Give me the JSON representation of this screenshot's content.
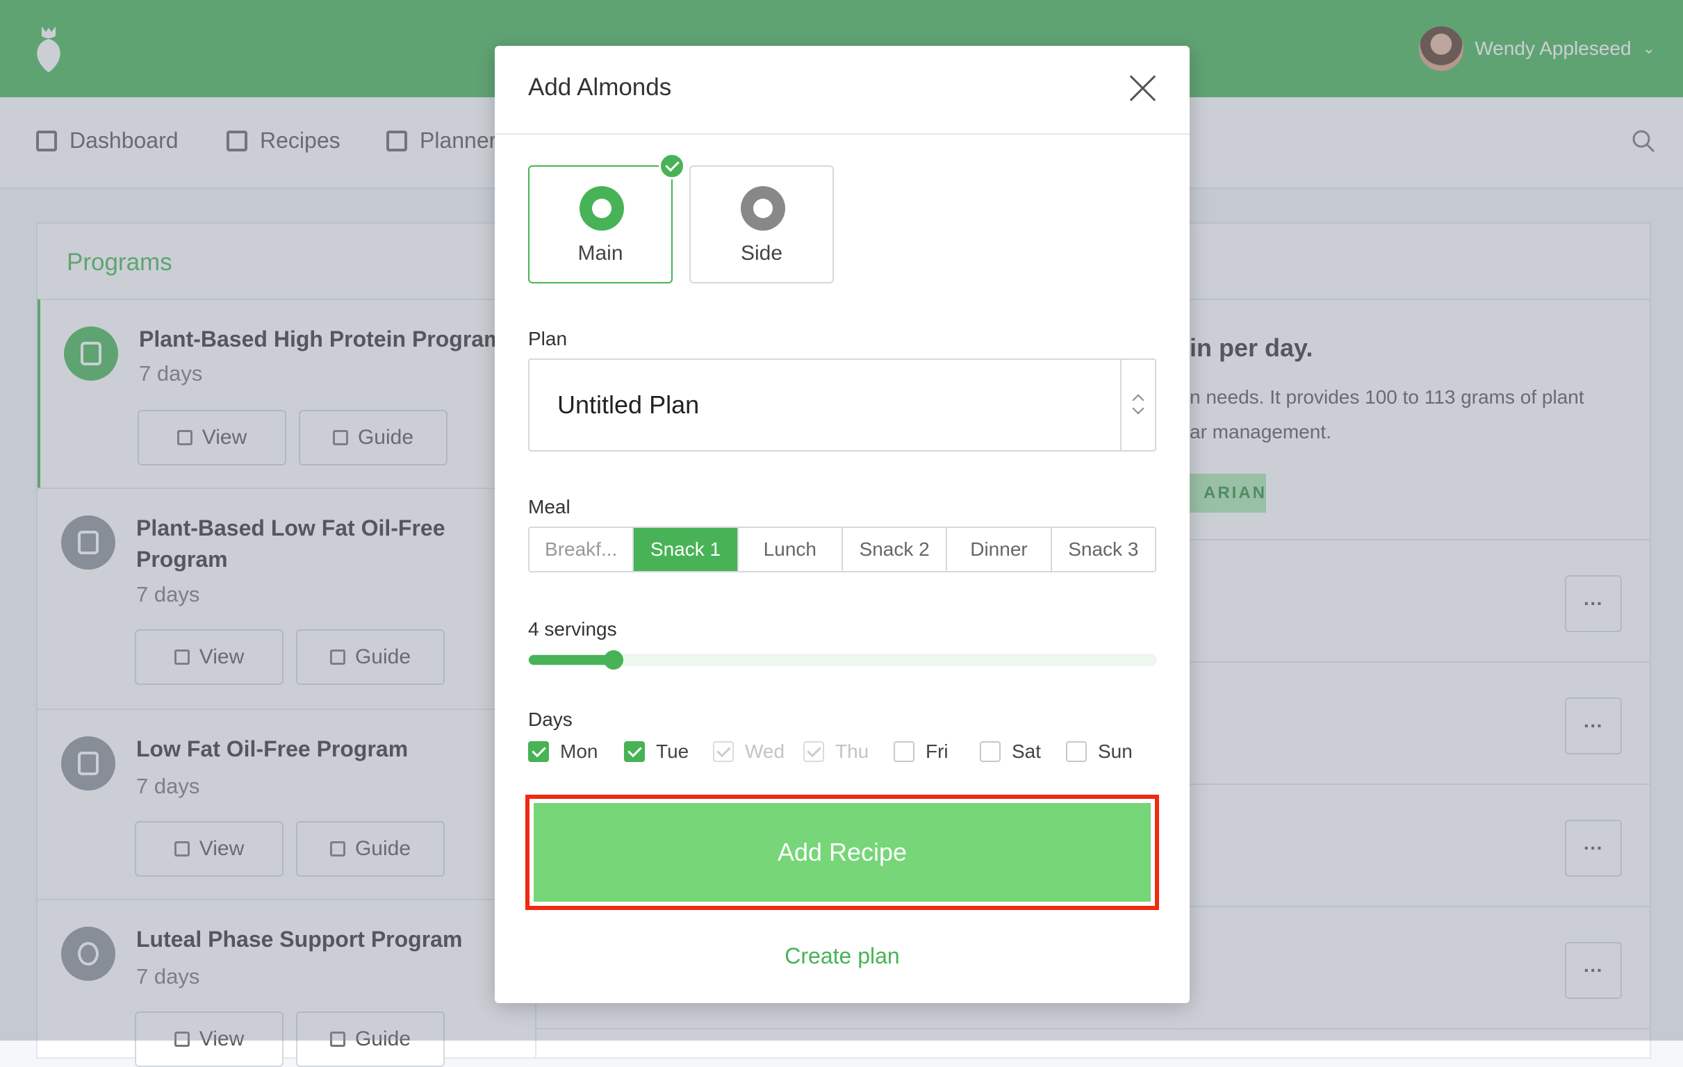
{
  "user": {
    "name": "Wendy Appleseed"
  },
  "nav": {
    "items": [
      "Dashboard",
      "Recipes",
      "Planner"
    ]
  },
  "programs": {
    "title": "Programs",
    "items": [
      {
        "title": "Plant-Based High Protein Program",
        "days": "7 days",
        "view": "View",
        "guide": "Guide"
      },
      {
        "title": "Plant-Based Low Fat Oil-Free Program",
        "days": "7 days",
        "view": "View",
        "guide": "Guide"
      },
      {
        "title": "Low Fat Oil-Free Program",
        "days": "7 days",
        "view": "View",
        "guide": "Guide"
      },
      {
        "title": "Luteal Phase Support Program",
        "days": "7 days",
        "view": "View",
        "guide": "Guide"
      }
    ]
  },
  "detail": {
    "heading": "in per day.",
    "line1": "n needs. It provides 100 to 113 grams of plant",
    "line2": "ar management.",
    "tag": "ARIAN",
    "more": "···"
  },
  "modal": {
    "title": "Add Almonds",
    "types": [
      {
        "label": "Main",
        "selected": true
      },
      {
        "label": "Side",
        "selected": false
      }
    ],
    "plan_label": "Plan",
    "plan_value": "Untitled Plan",
    "meal_label": "Meal",
    "meals": [
      "Breakf...",
      "Snack 1",
      "Lunch",
      "Snack 2",
      "Dinner",
      "Snack 3"
    ],
    "meal_selected": "Snack 1",
    "servings_label": "4 servings",
    "servings_fraction": 0.135,
    "days_label": "Days",
    "days": [
      {
        "label": "Mon",
        "state": "checked"
      },
      {
        "label": "Tue",
        "state": "checked"
      },
      {
        "label": "Wed",
        "state": "disabled"
      },
      {
        "label": "Thu",
        "state": "disabled"
      },
      {
        "label": "Fri",
        "state": "unchecked"
      },
      {
        "label": "Sat",
        "state": "unchecked"
      },
      {
        "label": "Sun",
        "state": "unchecked"
      }
    ],
    "add_button": "Add Recipe",
    "create_link": "Create plan"
  },
  "colors": {
    "brand": "#47b356",
    "highlight": "#f02a10"
  }
}
